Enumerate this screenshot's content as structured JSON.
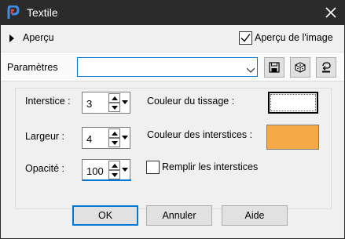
{
  "window": {
    "title": "Textile"
  },
  "apercu": {
    "label": "Aperçu",
    "image_preview_label": "Aperçu de l'image",
    "image_preview_checked": true
  },
  "params": {
    "label": "Paramètres",
    "preset_value": ""
  },
  "fields": {
    "interstice": {
      "label": "Interstice :",
      "value": "3"
    },
    "largeur": {
      "label": "Largeur :",
      "value": "4"
    },
    "opacite": {
      "label": "Opacité :",
      "value": "100"
    }
  },
  "colors": {
    "tissage": {
      "label": "Couleur du tissage :",
      "value": "#ffffff"
    },
    "interstices": {
      "label": "Couleur des interstices :",
      "value": "#f5a947"
    }
  },
  "remplir": {
    "label": "Remplir les interstices",
    "checked": false
  },
  "buttons": {
    "ok": "OK",
    "annuler": "Annuler",
    "aide": "Aide"
  },
  "icons": [
    "app-logo-icon",
    "close-icon",
    "expand-arrow-icon",
    "dropdown-arrow-icon",
    "save-preset-icon",
    "random-dice-icon",
    "reset-icon",
    "spin-up-icon",
    "spin-down-icon"
  ]
}
